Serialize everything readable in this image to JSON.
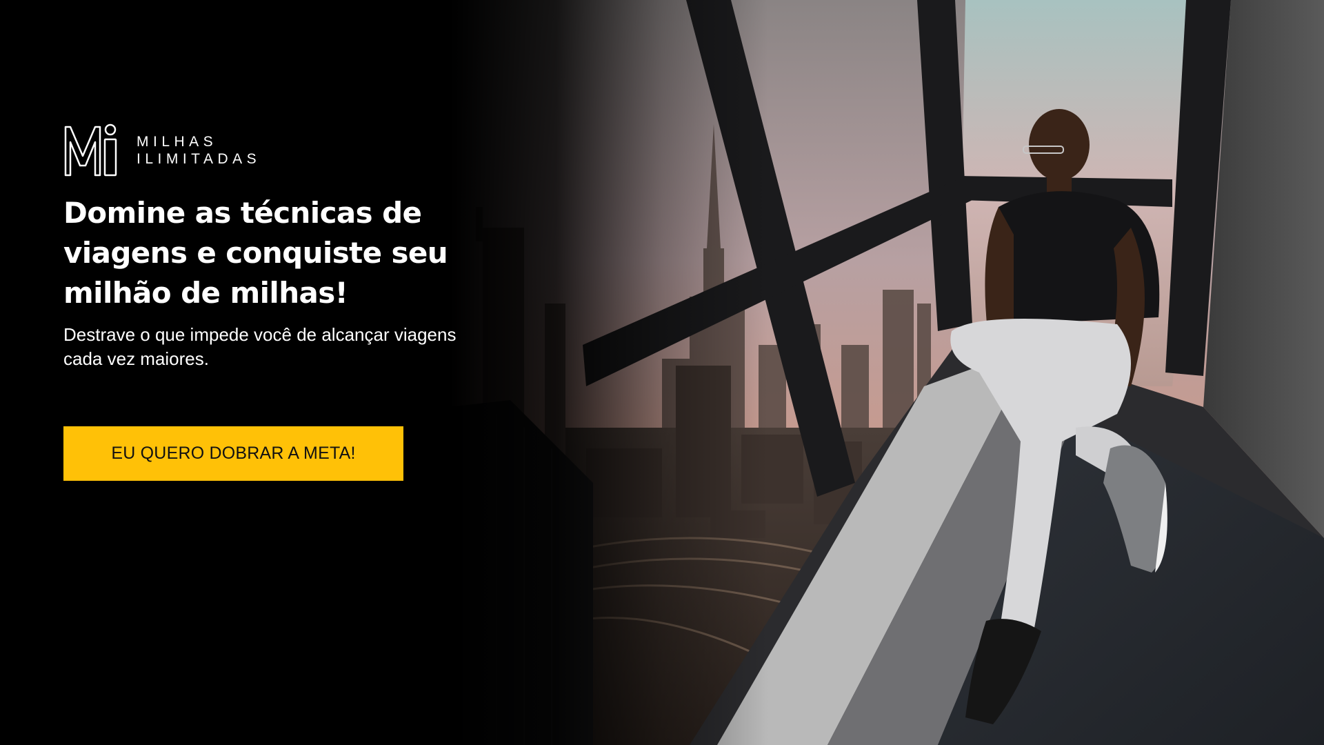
{
  "brand": {
    "line1": "MILHAS",
    "line2": "ILIMITADAS",
    "icon": "mi-monogram-icon"
  },
  "hero": {
    "headline": "Domine as técnicas de viagens e conquiste seu milhão de milhas!",
    "subheadline": "Destrave o que impede você de alcançar viagens cada vez maiores.",
    "cta_label": "EU QUERO DOBRAR A META!"
  },
  "colors": {
    "background": "#000000",
    "accent": "#ffc107",
    "text": "#ffffff",
    "cta_text": "#111111"
  }
}
